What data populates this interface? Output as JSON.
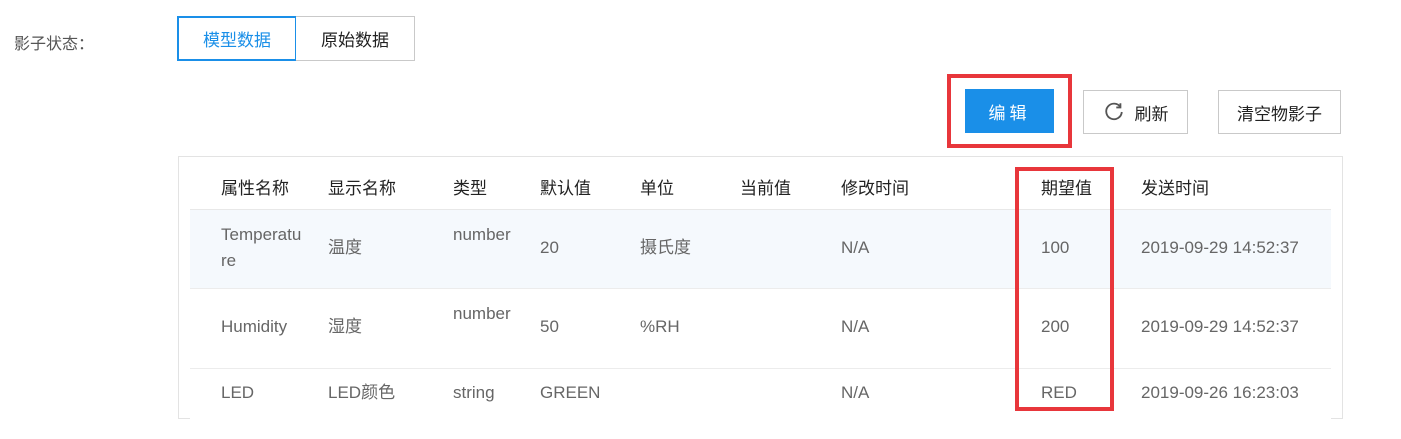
{
  "shadow_state": {
    "label": "影子状态：",
    "tabs": [
      {
        "label": "模型数据",
        "active": true
      },
      {
        "label": "原始数据",
        "active": false
      }
    ]
  },
  "toolbar": {
    "edit_label": "编辑",
    "refresh_label": "刷新",
    "clear_label": "清空物影子"
  },
  "table": {
    "headers": [
      "属性名称",
      "显示名称",
      "类型",
      "默认值",
      "单位",
      "当前值",
      "修改时间",
      "期望值",
      "发送时间"
    ],
    "rows": [
      {
        "name": "Temperature",
        "display": "温度",
        "type": "number",
        "default": "20",
        "unit": "摄氏度",
        "current": "",
        "modified": "N/A",
        "expected": "100",
        "sent": "2019-09-29 14:52:37"
      },
      {
        "name": "Humidity",
        "display": "湿度",
        "type": "number",
        "default": "50",
        "unit": "%RH",
        "current": "",
        "modified": "N/A",
        "expected": "200",
        "sent": "2019-09-29 14:52:37"
      },
      {
        "name": "LED",
        "display": "LED颜色",
        "type": "string",
        "default": "GREEN",
        "unit": "",
        "current": "",
        "modified": "N/A",
        "expected": "RED",
        "sent": "2019-09-26 16:23:03"
      }
    ]
  },
  "colors": {
    "accent": "#1a8fe8",
    "highlight": "#e8363b",
    "row_hover": "#f5f9fd"
  }
}
